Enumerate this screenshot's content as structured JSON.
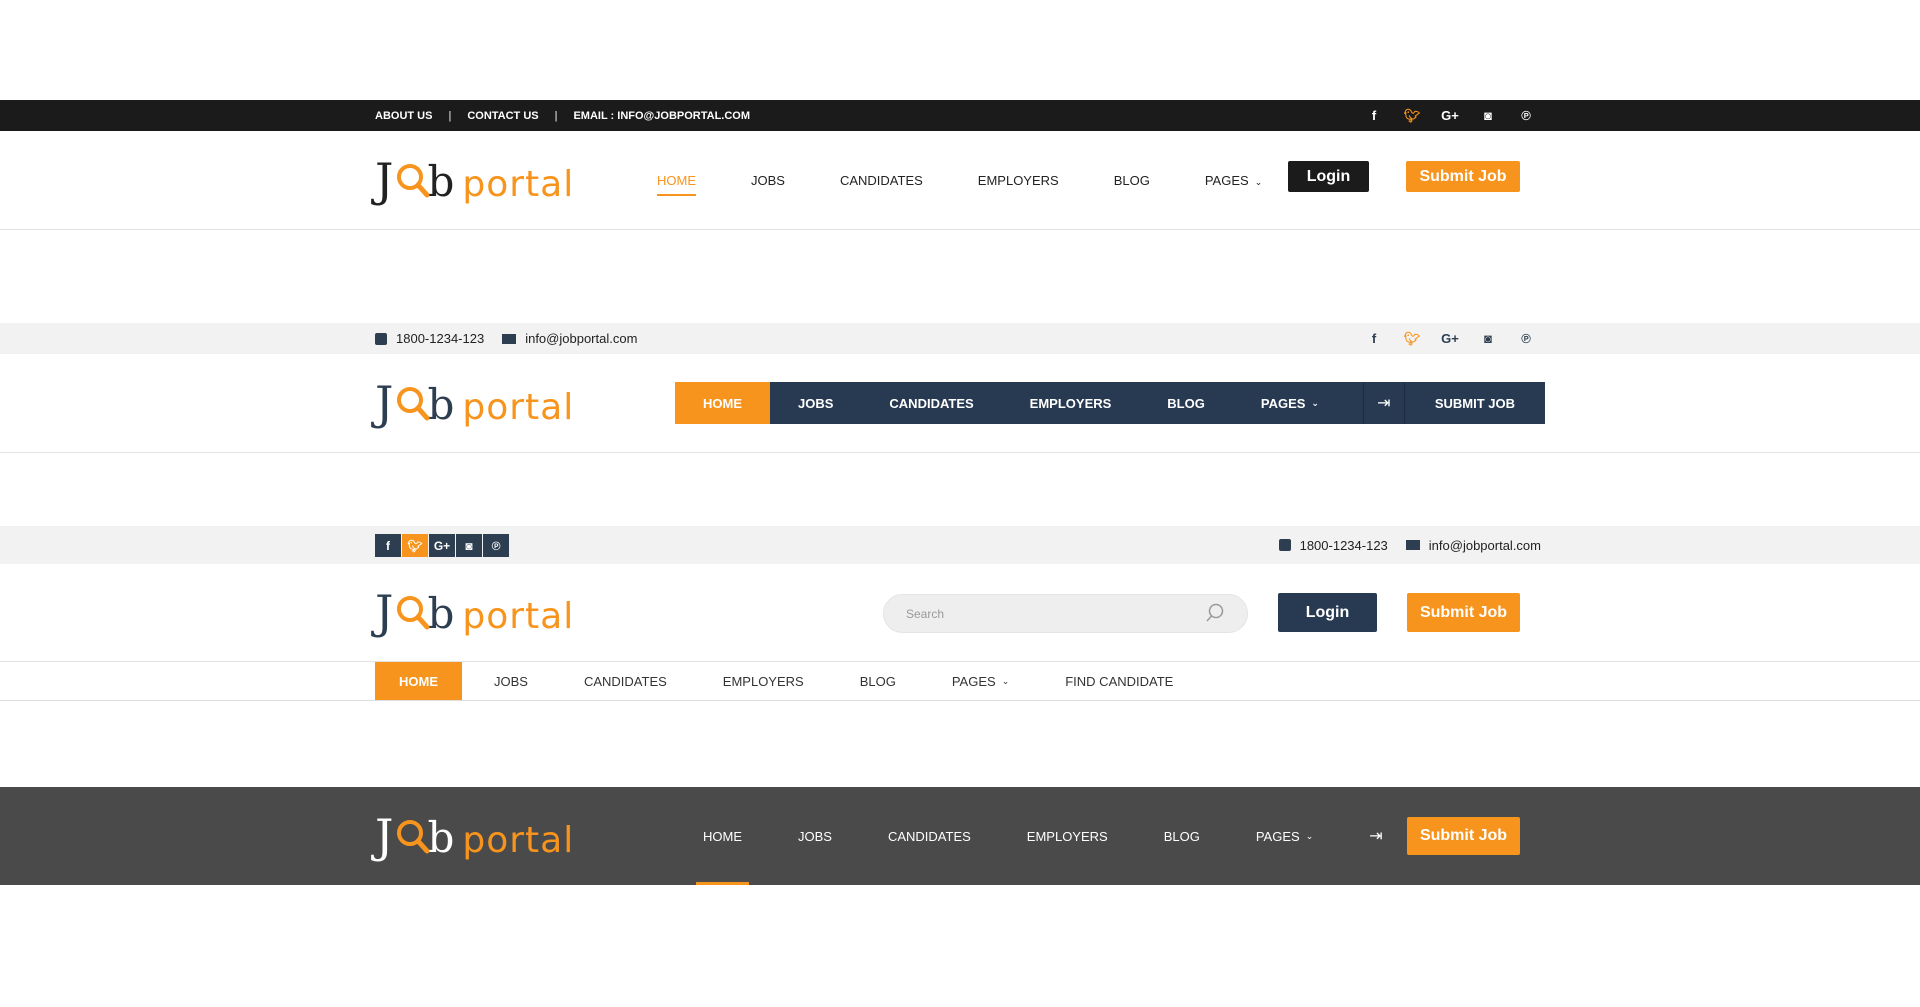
{
  "colors": {
    "accent": "#f7941d",
    "dark": "#1b1b1b",
    "navy": "#283a52",
    "grey_bar": "#4a4a4a"
  },
  "logo": {
    "j": "J",
    "b": "b",
    "portal": "portal"
  },
  "social_icons": [
    "facebook-icon",
    "twitter-icon",
    "google-plus-icon",
    "instagram-icon",
    "pinterest-icon"
  ],
  "header1": {
    "top_links": [
      "ABOUT US",
      "CONTACT US",
      "EMAIL : INFO@JOBPORTAL.COM"
    ],
    "nav": [
      "HOME",
      "JOBS",
      "CANDIDATES",
      "EMPLOYERS",
      "BLOG",
      "PAGES"
    ],
    "login_label": "Login",
    "submit_label": "Submit Job"
  },
  "header2": {
    "phone": "1800-1234-123",
    "email": "info@jobportal.com",
    "nav": [
      "HOME",
      "JOBS",
      "CANDIDATES",
      "EMPLOYERS",
      "BLOG",
      "PAGES"
    ],
    "submit_label": "SUBMIT JOB"
  },
  "header3": {
    "phone": "1800-1234-123",
    "email": "info@jobportal.com",
    "search_placeholder": "Search",
    "login_label": "Login",
    "submit_label": "Submit Job",
    "nav": [
      "HOME",
      "JOBS",
      "CANDIDATES",
      "EMPLOYERS",
      "BLOG",
      "PAGES",
      "FIND CANDIDATE"
    ]
  },
  "header4": {
    "nav": [
      "HOME",
      "JOBS",
      "CANDIDATES",
      "EMPLOYERS",
      "BLOG",
      "PAGES"
    ],
    "submit_label": "Submit Job"
  }
}
